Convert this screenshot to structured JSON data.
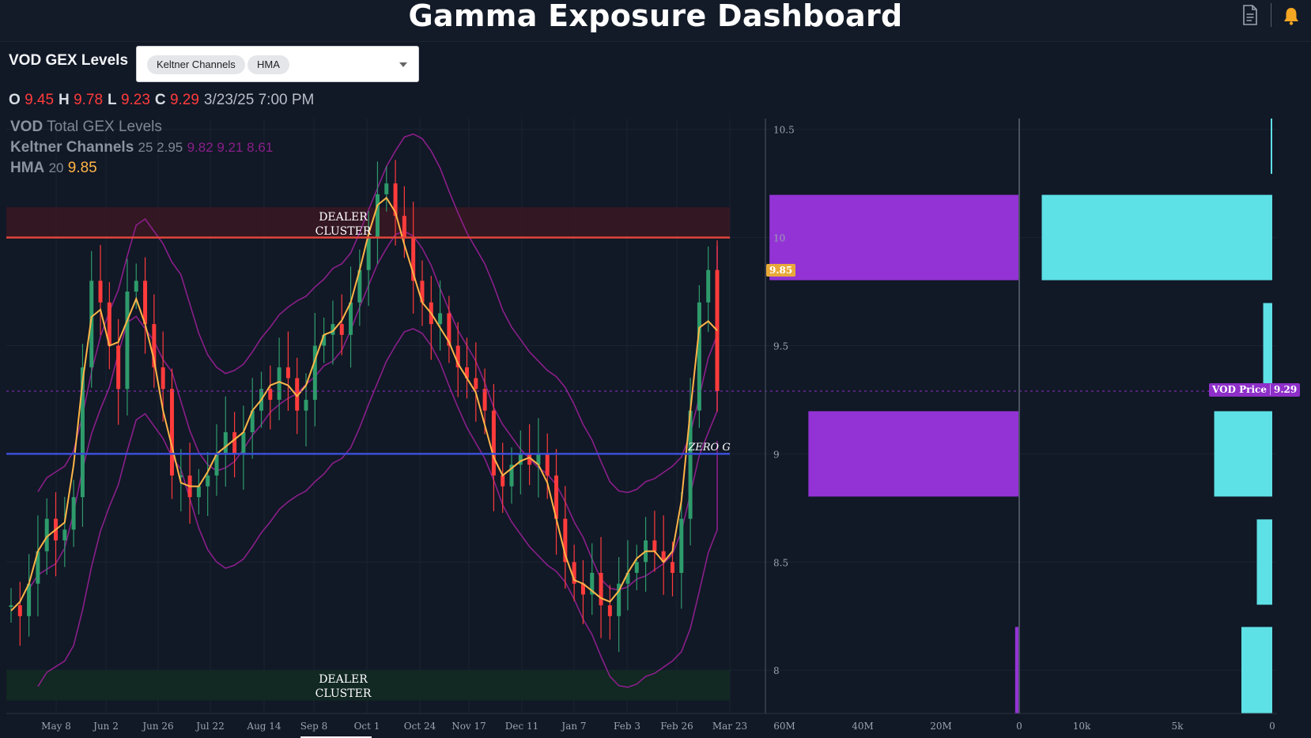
{
  "header": {
    "title": "Gamma Exposure Dashboard",
    "icons": [
      "document-icon",
      "bell-icon"
    ],
    "bell_color": "#f5a623"
  },
  "toolbar": {
    "section_title": "VOD GEX Levels",
    "selected_indicators": [
      "Keltner Channels",
      "HMA"
    ]
  },
  "ohlc": {
    "open_label": "O",
    "open": "9.45",
    "high_label": "H",
    "high": "9.78",
    "low_label": "L",
    "low": "9.23",
    "close_label": "C",
    "close": "9.29",
    "timestamp": "3/23/25 7:00 PM"
  },
  "legend": {
    "symbol": "VOD",
    "gex_label": "Total GEX Levels",
    "keltner_label": "Keltner Channels",
    "keltner_params": "25 2.95",
    "keltner_values": "9.82 9.21 8.61",
    "hma_label": "HMA",
    "hma_param": "20",
    "hma_value": "9.85"
  },
  "annotations": {
    "dealer_cluster_top": [
      "DEALER",
      "CLUSTER"
    ],
    "dealer_cluster_bottom": [
      "DEALER",
      "CLUSTER"
    ],
    "zero_gamma": "ZERO G",
    "hma_tag": "9.85",
    "price_tag_label": "VOD Price",
    "price_tag_value": "9.29"
  },
  "colors": {
    "background": "#111826",
    "up_candle": "#2e9b6b",
    "down_candle": "#ff3b3b",
    "hma": "#ffb547",
    "keltner": "#8a1f8a",
    "resistance": "#e0453a",
    "zero_gamma": "#3b4fd8",
    "gex_bar": "#9333d6",
    "volume_bar": "#5de0e6",
    "price_tag": "#8e2fc9"
  },
  "chart_data": [
    {
      "type": "candlestick",
      "title": "VOD Total GEX Levels",
      "x_ticks": [
        "May 8",
        "Jun 2",
        "Jun 26",
        "Jul 22",
        "Aug 14",
        "Sep 8",
        "Oct 1",
        "Oct 24",
        "Nov 17",
        "Dec 11",
        "Jan 7",
        "Feb 3",
        "Feb 26",
        "Mar 23"
      ],
      "ylim": [
        7.8,
        10.55
      ],
      "levels": {
        "dealer_cluster_top": 10.0,
        "zero_gamma": 9.0,
        "dealer_cluster_bottom": 7.92
      },
      "close_series": [
        8.3,
        8.25,
        8.4,
        8.55,
        8.7,
        8.6,
        8.65,
        8.8,
        9.4,
        9.8,
        9.7,
        9.5,
        9.3,
        9.75,
        9.8,
        9.6,
        9.4,
        9.3,
        8.9,
        8.9,
        8.8,
        8.85,
        8.9,
        9.0,
        9.1,
        9.0,
        9.1,
        9.2,
        9.3,
        9.25,
        9.4,
        9.35,
        9.2,
        9.25,
        9.5,
        9.55,
        9.6,
        9.55,
        9.7,
        9.85,
        10.0,
        10.2,
        10.25,
        10.1,
        10.0,
        9.8,
        9.7,
        9.6,
        9.65,
        9.5,
        9.4,
        9.35,
        9.3,
        9.2,
        8.9,
        8.85,
        8.95,
        9.0,
        8.95,
        9.0,
        8.9,
        8.7,
        8.5,
        8.4,
        8.35,
        8.45,
        8.3,
        8.25,
        8.4,
        8.45,
        8.5,
        8.6,
        8.55,
        8.5,
        8.45,
        8.7,
        9.2,
        9.7,
        9.85,
        9.29
      ]
    },
    {
      "type": "bar",
      "title": "",
      "orientation": "horizontal",
      "y_ticks": [
        "10.5",
        "10",
        "9.5",
        "9",
        "8.5",
        "8"
      ],
      "gex": {
        "x_ticks": [
          "60M",
          "40M",
          "20M",
          "0"
        ],
        "xlim": [
          62000000,
          0
        ],
        "bars": [
          {
            "level": 10.0,
            "value": 61000000
          },
          {
            "level": 9.0,
            "value": 51500000
          },
          {
            "level": 8.0,
            "value": 1000000
          }
        ]
      },
      "volume": {
        "x_ticks": [
          "10k",
          "5k",
          "0"
        ],
        "xlim": [
          13200,
          0
        ],
        "bars": [
          {
            "level": 10.5,
            "value": 80
          },
          {
            "level": 10.0,
            "value": 12700
          },
          {
            "level": 9.5,
            "value": 500
          },
          {
            "level": 9.0,
            "value": 3200
          },
          {
            "level": 8.5,
            "value": 850
          },
          {
            "level": 8.0,
            "value": 1700
          }
        ]
      }
    }
  ]
}
